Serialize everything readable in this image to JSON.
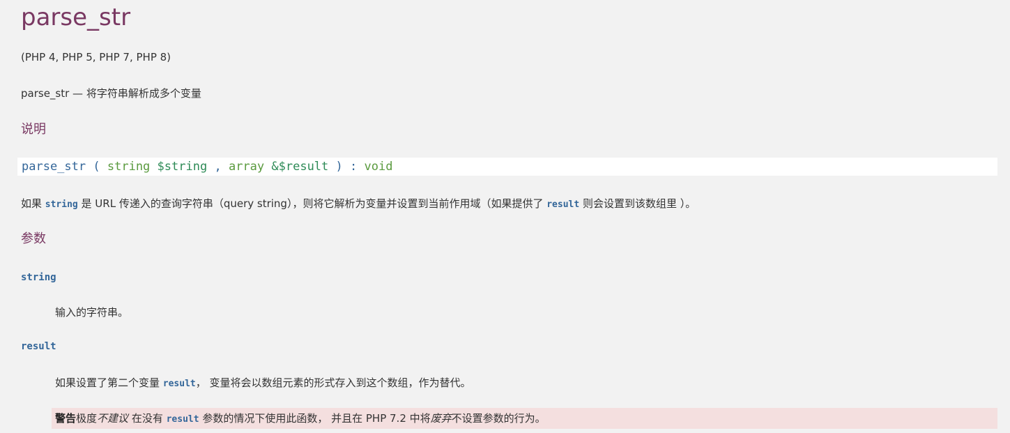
{
  "page": {
    "title": "parse_str",
    "versions": "(PHP 4, PHP 5, PHP 7, PHP 8)",
    "refname": "parse_str — 将字符串解析成多个变量"
  },
  "description": {
    "heading": "说明",
    "synopsis": {
      "function_name": "parse_str",
      "open_paren": "(",
      "param1_type": "string",
      "param1_var": "$string",
      "separator": ",",
      "param2_type": "array",
      "param2_var": "&$result",
      "close_paren": ")",
      "return_colon": ":",
      "return_type": "void"
    },
    "text": {
      "p1": "如果 ",
      "code1": "string",
      "p2": " 是 URL 传递入的查询字符串（query string），则将它解析为变量并设置到当前作用域（如果提供了 ",
      "code2": "result",
      "p3": " 则会设置到该数组里 ）。"
    }
  },
  "parameters": {
    "heading": "参数",
    "items": [
      {
        "term": "string",
        "definition": "输入的字符串。"
      },
      {
        "term": "result",
        "definition_prefix": "如果设置了第二个变量 ",
        "definition_code": "result",
        "definition_suffix": "， 变量将会以数组元素的形式存入到这个数组，作为替代。"
      }
    ],
    "warning": {
      "label": "警告",
      "t1": "极度",
      "em1": "不建议",
      "t2": " 在没有 ",
      "code": "result",
      "t3": " 参数的情况下使用此函数， 并且在 PHP 7.2 中将",
      "em2": "废弃",
      "t4": "不设置参数的行为。"
    }
  },
  "colors": {
    "title": "#793862",
    "code": "#336699",
    "type": "#5a9a3e",
    "warning_bg": "#f4dfdf",
    "page_bg": "#f2f2f2"
  }
}
